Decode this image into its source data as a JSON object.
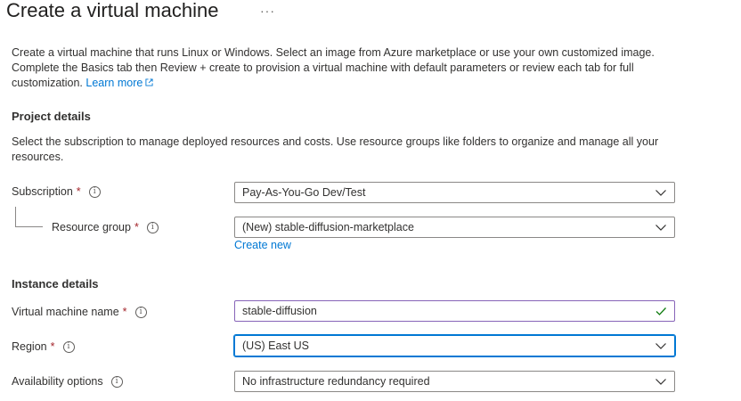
{
  "page": {
    "title": "Create a virtual machine",
    "more_label": "···"
  },
  "intro": {
    "text": "Create a virtual machine that runs Linux or Windows. Select an image from Azure marketplace or use your own customized image. Complete the Basics tab then Review + create to provision a virtual machine with default parameters or review each tab for full customization.",
    "learn_more": "Learn more"
  },
  "project_details": {
    "heading": "Project details",
    "description": "Select the subscription to manage deployed resources and costs. Use resource groups like folders to organize and manage all your resources.",
    "subscription": {
      "label": "Subscription",
      "required_mark": "*",
      "value": "Pay-As-You-Go Dev/Test"
    },
    "resource_group": {
      "label": "Resource group",
      "required_mark": "*",
      "value": "(New) stable-diffusion-marketplace",
      "create_new": "Create new"
    }
  },
  "instance_details": {
    "heading": "Instance details",
    "vm_name": {
      "label": "Virtual machine name",
      "required_mark": "*",
      "value": "stable-diffusion"
    },
    "region": {
      "label": "Region",
      "required_mark": "*",
      "value": "(US) East US"
    },
    "availability": {
      "label": "Availability options",
      "value": "No infrastructure redundancy required"
    }
  },
  "colors": {
    "link": "#0078d4",
    "required": "#a4262c",
    "focus_border": "#0078d4",
    "valid_check": "#107c10"
  },
  "icons": {
    "info": "info-circle-icon",
    "chevron": "chevron-down-icon",
    "external": "external-link-icon",
    "check": "checkmark-icon"
  }
}
